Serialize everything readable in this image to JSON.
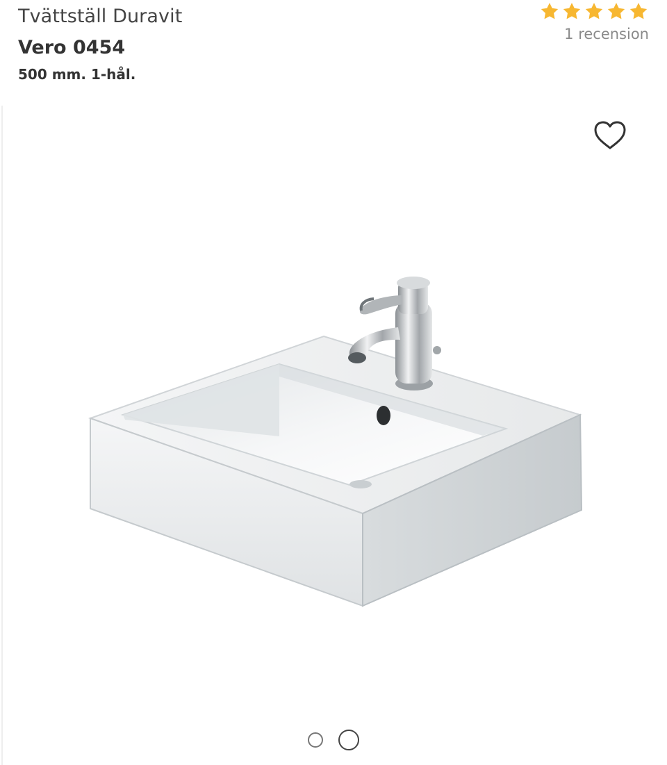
{
  "product": {
    "category": "Tvättställ Duravit",
    "name": "Vero 0454",
    "spec": "500 mm. 1-hål."
  },
  "rating": {
    "stars": 5,
    "review_count_text": "1 recension",
    "star_color": "#F7B731"
  },
  "gallery": {
    "favorite_icon": "heart-outline-icon",
    "image_description": "sink-product-image",
    "dots": [
      {
        "name": "gallery-dot-1",
        "active": false
      },
      {
        "name": "gallery-dot-2",
        "active": true
      }
    ]
  }
}
